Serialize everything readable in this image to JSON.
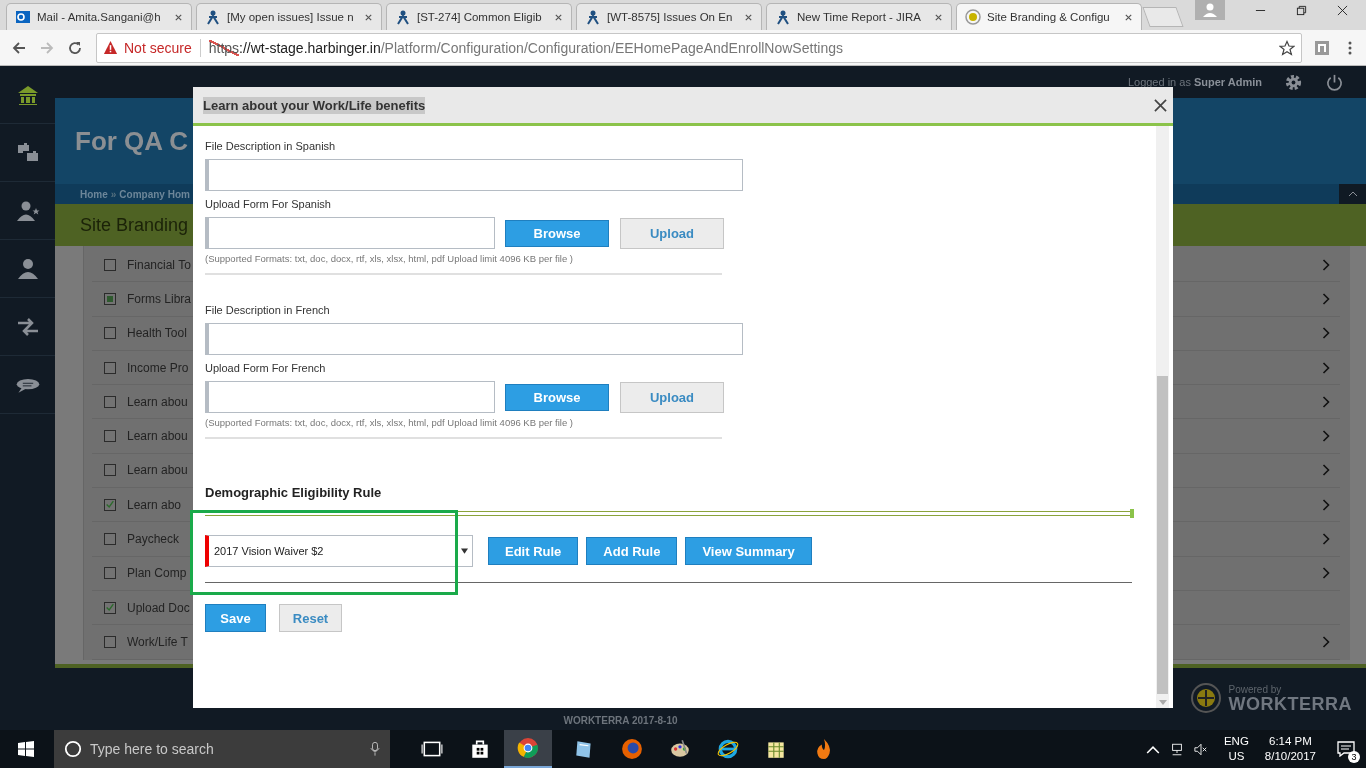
{
  "browser": {
    "tabs": [
      {
        "label": "Mail - Amita.Sangani@h",
        "selected": false
      },
      {
        "label": "[My open issues] Issue n",
        "selected": false
      },
      {
        "label": "[ST-274] Common Eligib",
        "selected": false
      },
      {
        "label": "[WT-8575] Issues On En",
        "selected": false
      },
      {
        "label": "New Time Report - JIRA",
        "selected": false
      },
      {
        "label": "Site Branding & Configu",
        "selected": true
      }
    ],
    "security": "Not secure",
    "url": {
      "scheme": "https",
      "host": "://wt-stage.harbinger.in",
      "path": "/Platform/Configuration/Configuration/EEHomePageAndEnrollNowSettings"
    }
  },
  "app": {
    "user_text": "Logged in as **Super Admin**",
    "header_title": "For QA C",
    "breadcrumb": [
      "Home",
      "Company Hom"
    ],
    "breadcrumb_separator": "»",
    "page_title": "Site Branding",
    "items": [
      {
        "label": "Financial To",
        "checked": false,
        "indeterminate": false,
        "has_arrow": true
      },
      {
        "label": "Forms Libra",
        "checked": false,
        "indeterminate": true,
        "has_arrow": true
      },
      {
        "label": "Health Tool",
        "checked": false,
        "indeterminate": false,
        "has_arrow": true
      },
      {
        "label": "Income Pro",
        "checked": false,
        "indeterminate": false,
        "has_arrow": true
      },
      {
        "label": "Learn abou",
        "checked": false,
        "indeterminate": false,
        "has_arrow": true
      },
      {
        "label": "Learn abou",
        "checked": false,
        "indeterminate": false,
        "has_arrow": true
      },
      {
        "label": "Learn abou",
        "checked": false,
        "indeterminate": false,
        "has_arrow": true
      },
      {
        "label": "Learn abo",
        "checked": true,
        "indeterminate": false,
        "has_arrow": true
      },
      {
        "label": "Paycheck",
        "checked": false,
        "indeterminate": false,
        "has_arrow": true
      },
      {
        "label": "Plan Comp",
        "checked": false,
        "indeterminate": false,
        "has_arrow": true
      },
      {
        "label": "Upload Doc",
        "checked": true,
        "indeterminate": false,
        "has_arrow": false
      },
      {
        "label": "Work/Life T",
        "checked": false,
        "indeterminate": false,
        "has_arrow": true
      }
    ],
    "footer_text": "WORKTERRA 2017-8-10",
    "powered_by": "Powered by",
    "brand": "WORKTERRA"
  },
  "dialog": {
    "title": "Learn about your Work/Life benefits",
    "sections": [
      {
        "description_label": "File Description in Spanish",
        "upload_label": "Upload Form For Spanish",
        "browse": "Browse",
        "upload": "Upload",
        "note": "(Supported Formats: txt, doc, docx, rtf, xls, xlsx, html, pdf Upload limit 4096 KB per file )"
      },
      {
        "description_label": "File Description in French",
        "upload_label": "Upload Form For French",
        "browse": "Browse",
        "upload": "Upload",
        "note": "(Supported Formats: txt, doc, docx, rtf, xls, xlsx, html, pdf Upload limit 4096 KB per file )"
      }
    ],
    "rule_heading": "Demographic Eligibility Rule",
    "rule_value": "2017 Vision Waiver $2",
    "rule_buttons": [
      "Edit Rule",
      "Add Rule",
      "View Summary"
    ],
    "save": "Save",
    "reset": "Reset"
  },
  "taskbar": {
    "search_placeholder": "Type here to search",
    "language": "ENG",
    "region": "US",
    "time": "6:14 PM",
    "date": "8/10/2017",
    "notifications": "3"
  }
}
